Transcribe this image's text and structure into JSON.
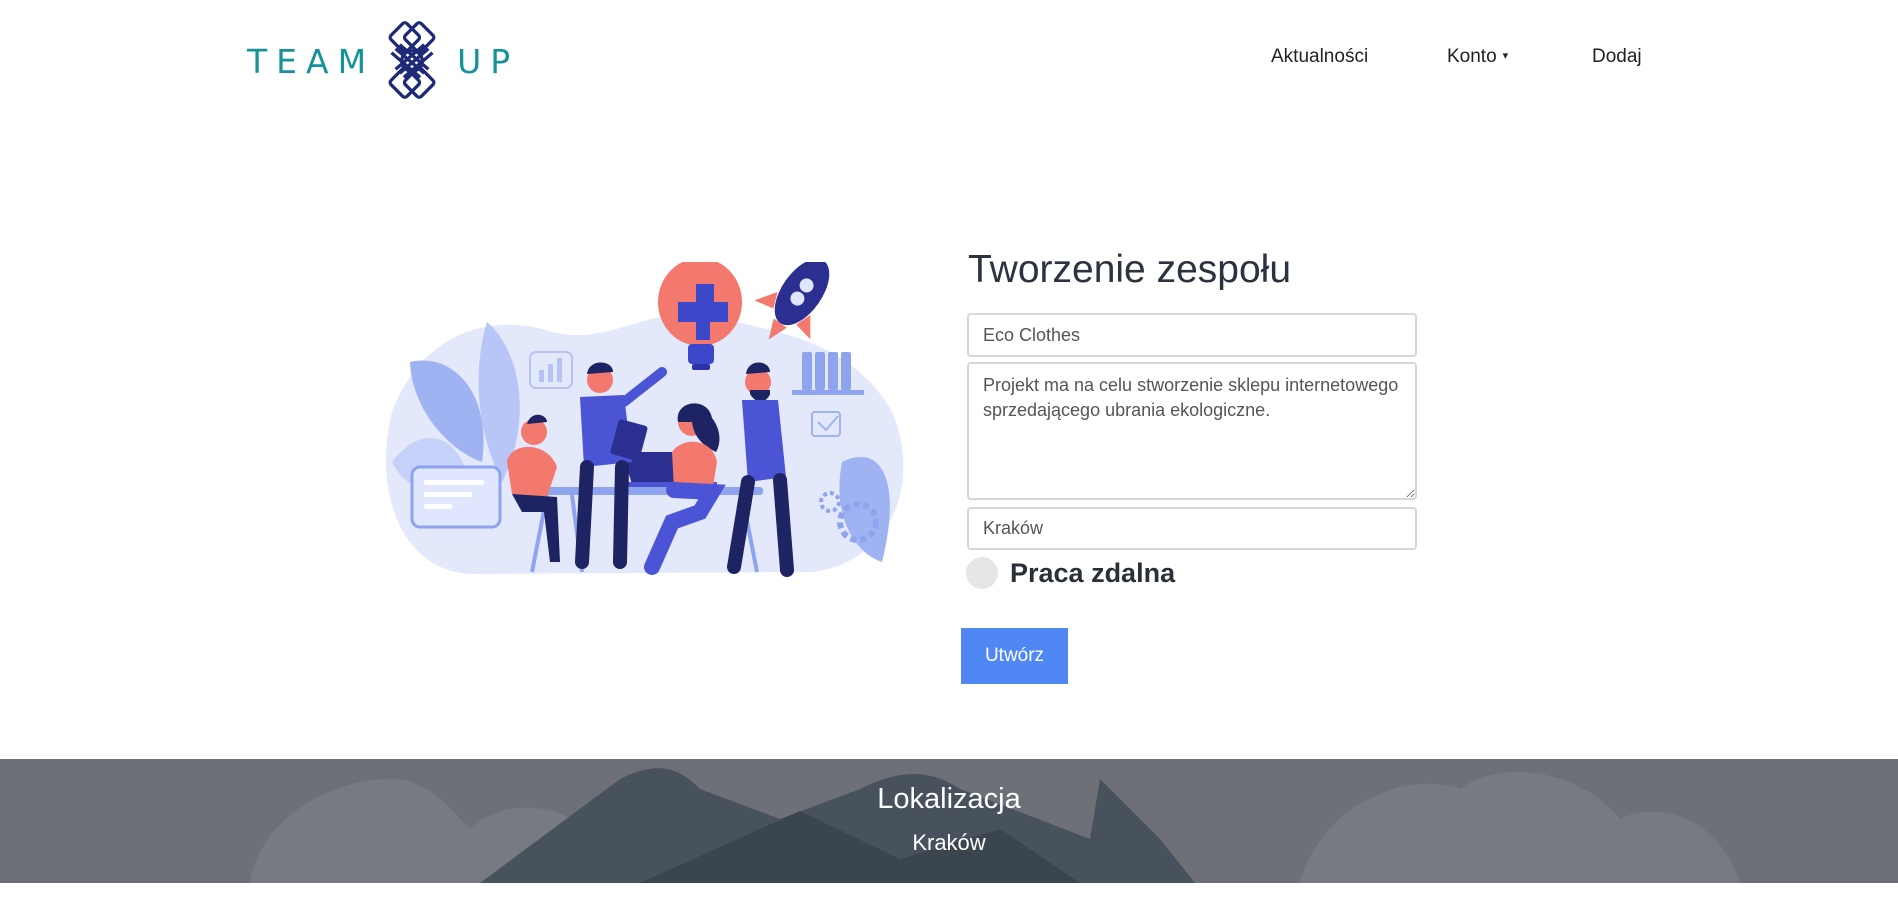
{
  "brand": {
    "left": "TEAM",
    "right": "UP",
    "color": "#16939a"
  },
  "nav": {
    "news": "Aktualności",
    "account": "Konto",
    "account_caret": "▾",
    "add": "Dodaj"
  },
  "form": {
    "title": "Tworzenie zespołu",
    "name_value": "Eco Clothes",
    "description_value": "Projekt ma na celu stworzenie sklepu internetowego sprzedającego ubrania ekologiczne.",
    "city_value": "Kraków",
    "remote_label": "Praca zdalna",
    "remote_checked": false,
    "submit_label": "Utwórz",
    "submit_color": "#4f87f5"
  },
  "location": {
    "title": "Lokalizacja",
    "city": "Kraków"
  }
}
